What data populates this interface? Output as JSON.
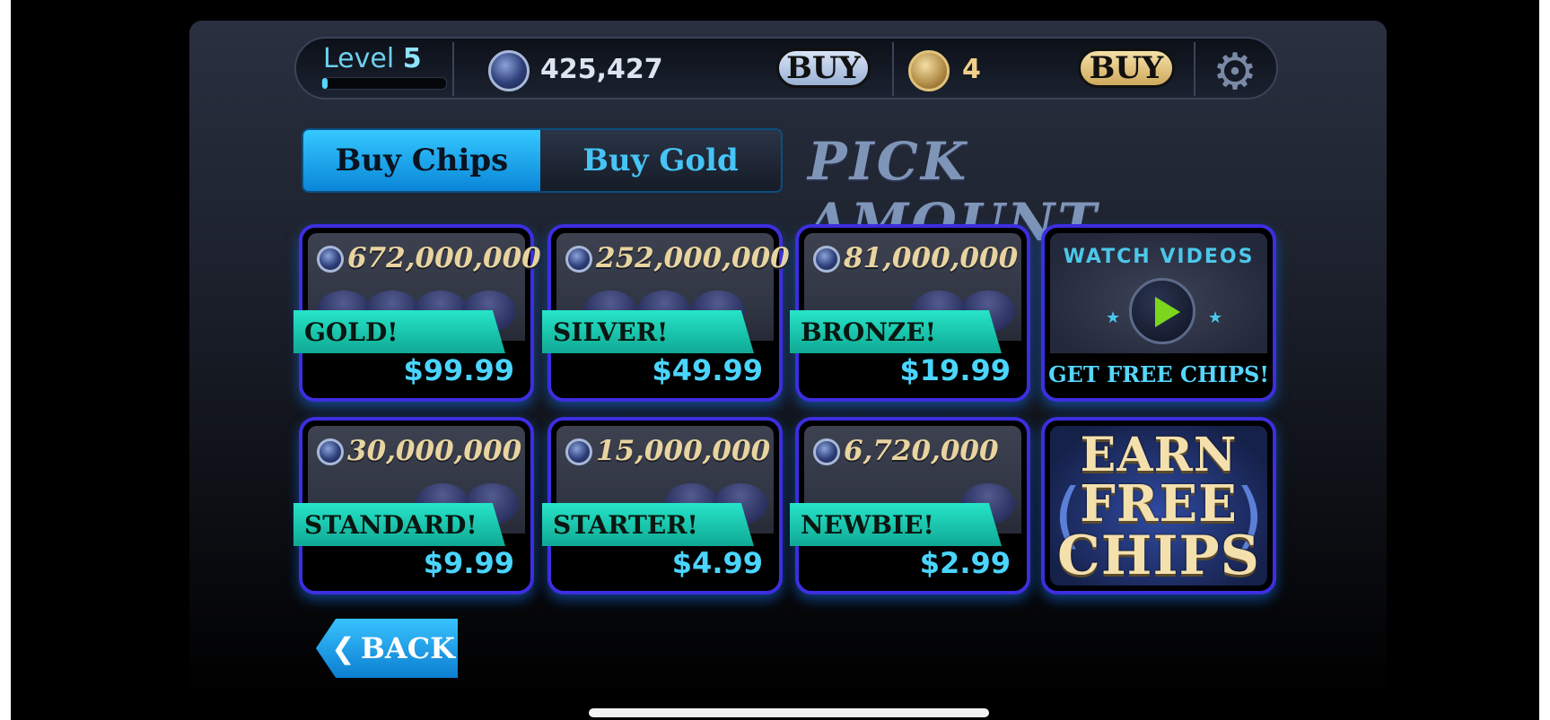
{
  "topbar": {
    "level_label": "Level",
    "level_value": "5",
    "level_progress": 0.04,
    "chips_balance": "425,427",
    "chips_buy_label": "BUY",
    "gold_balance": "4",
    "gold_buy_label": "BUY",
    "settings_icon": "gear-icon"
  },
  "tabs": {
    "buy_chips": "Buy Chips",
    "buy_gold": "Buy Gold",
    "active": "buy_chips"
  },
  "heading": "PICK AMOUNT",
  "packages": [
    {
      "amount": "672,000,000",
      "tier": "GOLD!",
      "price": "$99.99"
    },
    {
      "amount": "252,000,000",
      "tier": "SILVER!",
      "price": "$49.99"
    },
    {
      "amount": "81,000,000",
      "tier": "BRONZE!",
      "price": "$19.99"
    },
    {
      "amount": "30,000,000",
      "tier": "STANDARD!",
      "price": "$9.99"
    },
    {
      "amount": "15,000,000",
      "tier": "STARTER!",
      "price": "$4.99"
    },
    {
      "amount": "6,720,000",
      "tier": "NEWBIE!",
      "price": "$2.99"
    }
  ],
  "watch_videos": {
    "title": "WATCH VIDEOS",
    "label": "GET FREE CHIPS!",
    "icon": "play-icon"
  },
  "earn_free": {
    "line1": "EARN",
    "line2": "FREE",
    "line3": "CHIPS"
  },
  "back_label": "BACK",
  "colors": {
    "accent": "#35c8ff",
    "card_border": "#3d2ee0",
    "ribbon": "#1ccdb3",
    "price": "#4ad5ff",
    "gold_text": "#e9d49f"
  }
}
